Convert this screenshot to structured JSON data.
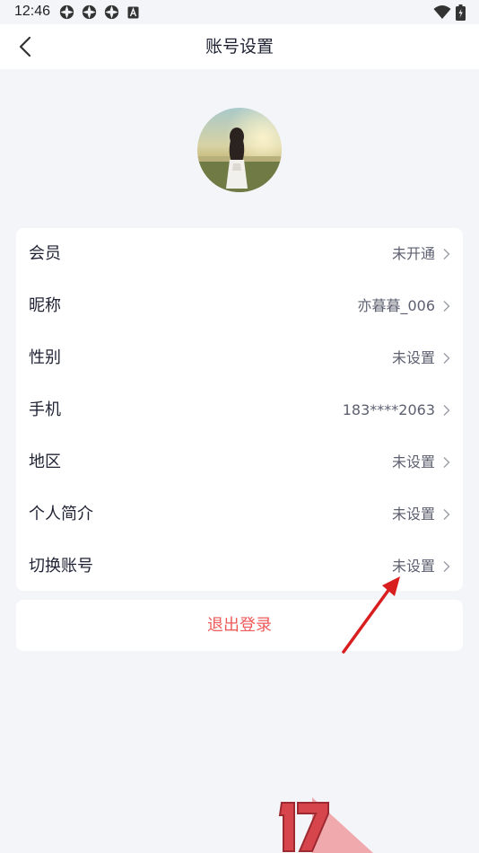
{
  "status_bar": {
    "time": "12:46",
    "left_icons": [
      "settings-gear-icon",
      "settings-gear-icon",
      "settings-gear-icon",
      "app-a-icon"
    ],
    "right_icons": [
      "wifi-icon",
      "battery-icon"
    ]
  },
  "header": {
    "title": "账号设置",
    "back_icon": "chevron-left-icon"
  },
  "profile": {
    "avatar_desc": "avatar"
  },
  "settings": {
    "rows": [
      {
        "label": "会员",
        "value": "未开通"
      },
      {
        "label": "昵称",
        "value": "亦暮暮_006"
      },
      {
        "label": "性别",
        "value": "未设置"
      },
      {
        "label": "手机",
        "value": "183****2063"
      },
      {
        "label": "地区",
        "value": "未设置"
      },
      {
        "label": "个人简介",
        "value": "未设置"
      },
      {
        "label": "切换账号",
        "value": "未设置"
      }
    ]
  },
  "logout": {
    "label": "退出登录"
  },
  "colors": {
    "background": "#f4f5f9",
    "card": "#ffffff",
    "text_primary": "#1f2233",
    "text_secondary": "#5d6070",
    "logout_red": "#ef5a5a",
    "annotation_red": "#d81e1e"
  },
  "overlay": {
    "watermark_text": "17"
  }
}
